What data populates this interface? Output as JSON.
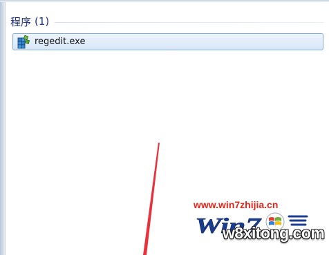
{
  "search_results": {
    "group_title": "程序",
    "group_count": "(1)",
    "items": [
      {
        "label": "regedit.exe",
        "icon": "registry-editor-icon"
      }
    ]
  },
  "watermark": {
    "url": "www.win7zhijia.cn",
    "logo_text": "Win7",
    "site": "w8xitong.com"
  },
  "colors": {
    "group_title": "#1e3287",
    "selection_border": "#84acdd",
    "selection_fill": "#dce9f8",
    "arrow": "#e8202a",
    "watermark_red": "#e1261c",
    "watermark_blue": "#1a3d8f"
  }
}
